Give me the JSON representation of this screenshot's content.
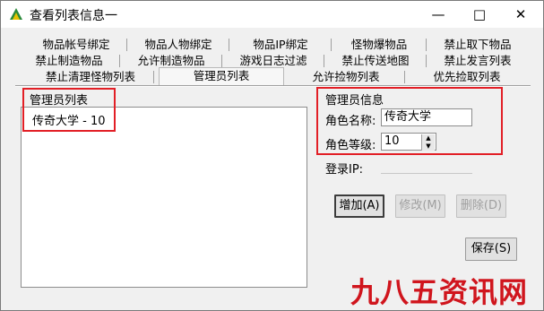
{
  "window": {
    "title": "查看列表信息一",
    "minimize": "—",
    "maximize": "□",
    "close": "✕"
  },
  "tabs": {
    "row1": [
      "物品帐号绑定",
      "物品人物绑定",
      "物品IP绑定",
      "怪物爆物品",
      "禁止取下物品"
    ],
    "row2": [
      "禁止制造物品",
      "允许制造物品",
      "游戏日志过滤",
      "禁止传送地图",
      "禁止发言列表"
    ],
    "row3": [
      "禁止清理怪物列表",
      "管理员列表",
      "允许捡物列表",
      "优先捡取列表"
    ]
  },
  "admin_list": {
    "title": "管理员列表",
    "items": [
      "传奇大学 - 10"
    ]
  },
  "admin_info": {
    "title": "管理员信息",
    "role_name_label": "角色名称:",
    "role_name_value": "传奇大学",
    "role_level_label": "角色等级:",
    "role_level_value": "10",
    "login_ip_label": "登录IP:",
    "login_ip_value": ""
  },
  "buttons": {
    "add": "增加(A)",
    "modify": "修改(M)",
    "delete": "删除(D)",
    "save": "保存(S)"
  },
  "watermark": "九八五资讯网",
  "colors": {
    "highlight_box": "#e21f26",
    "watermark": "#d0151d"
  }
}
